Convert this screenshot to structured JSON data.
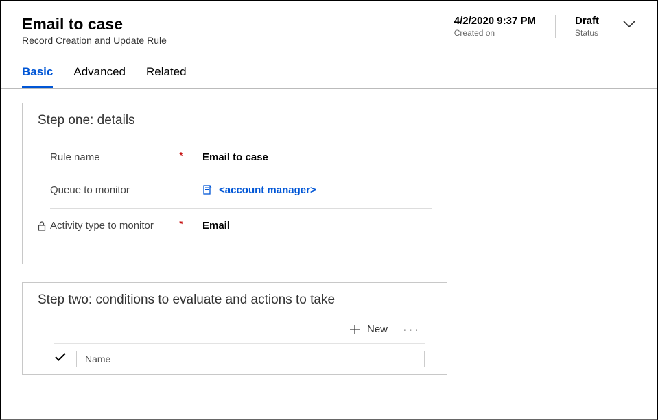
{
  "header": {
    "title": "Email to case",
    "subtitle": "Record Creation and Update Rule",
    "createdOn": {
      "value": "4/2/2020 9:37 PM",
      "label": "Created on"
    },
    "status": {
      "value": "Draft",
      "label": "Status"
    }
  },
  "tabs": {
    "basic": "Basic",
    "advanced": "Advanced",
    "related": "Related"
  },
  "stepOne": {
    "title": "Step one: details",
    "rows": {
      "ruleName": {
        "label": "Rule name",
        "value": "Email to case"
      },
      "queue": {
        "label": "Queue to monitor",
        "value": "<account manager>"
      },
      "activityType": {
        "label": "Activity type to monitor",
        "value": "Email"
      }
    }
  },
  "stepTwo": {
    "title": "Step two: conditions to evaluate and actions to take",
    "toolbar": {
      "newLabel": "New"
    },
    "columnName": "Name"
  }
}
